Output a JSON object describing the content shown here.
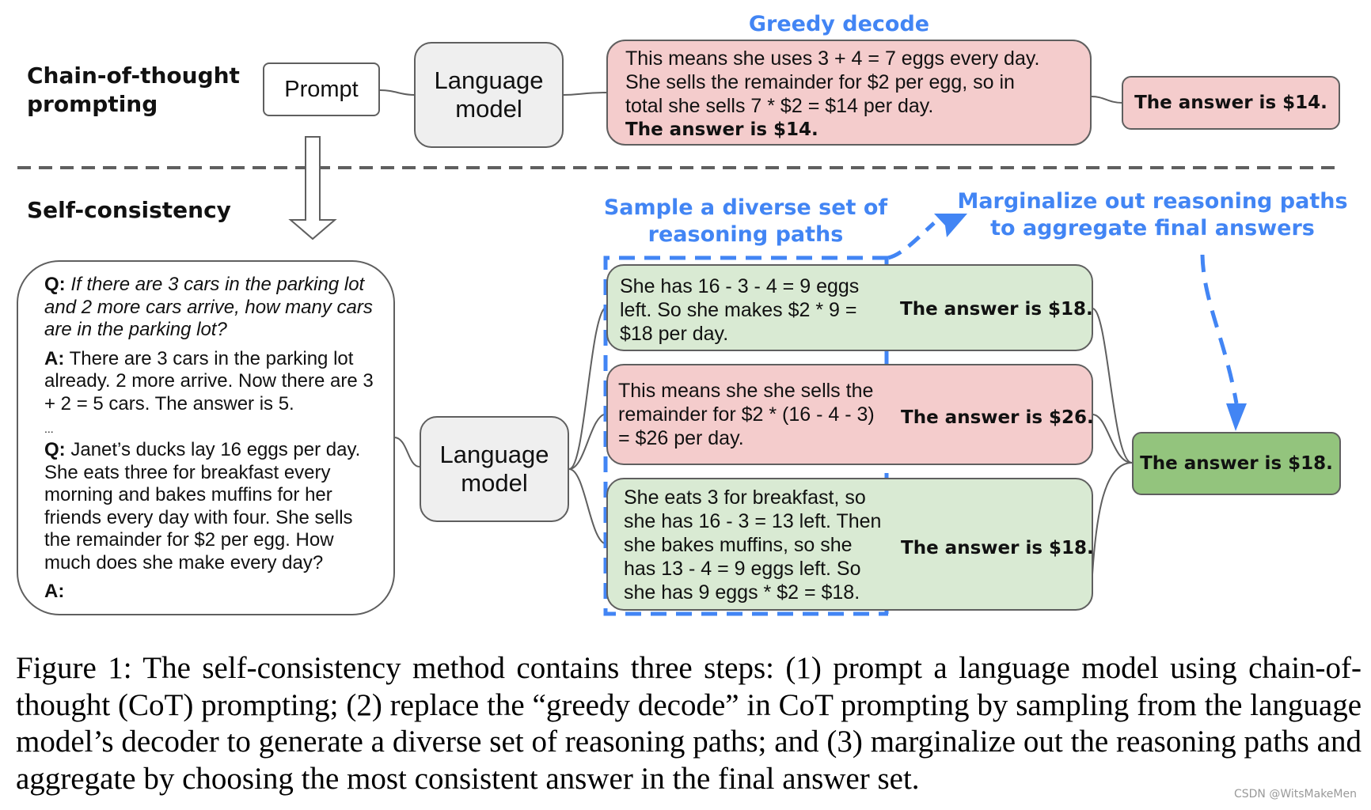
{
  "sections": {
    "cot_title": "Chain-of-thought\nprompting",
    "sc_title": "Self-consistency"
  },
  "cot": {
    "prompt_label": "Prompt",
    "lm_label_1": "Language",
    "lm_label_2": "model",
    "greedy_label": "Greedy decode",
    "greedy_lines": [
      "This means she uses 3 + 4 = 7 eggs every day.",
      "She sells the remainder for $2 per egg, so in",
      "total she sells 7 * $2 = $14 per day."
    ],
    "greedy_answer_inline": "The answer is $14.",
    "greedy_answer": "The answer is $14."
  },
  "sc": {
    "prompt": {
      "q1_label": "Q:",
      "q1_text": "If there are 3 cars in the parking lot and 2 more cars arrive, how many cars are in the parking lot?",
      "a1_label": "A:",
      "a1_text": "There are 3 cars in the parking lot already. 2 more arrive. Now there are 3 + 2 = 5 cars. The answer is 5.",
      "ellipsis": "...",
      "q2_label": "Q:",
      "q2_text": "Janet’s ducks lay 16 eggs per day. She eats three for breakfast every morning and bakes muffins for her friends every day with four. She sells the remainder for $2 per egg. How much does she make every day?",
      "a2_label": "A:"
    },
    "lm_label_1": "Language",
    "lm_label_2": "model",
    "sample_label_1": "Sample a diverse set of",
    "sample_label_2": "reasoning paths",
    "marginalize_label_1": "Marginalize out reasoning paths",
    "marginalize_label_2": "to aggregate final answers",
    "paths": [
      {
        "color": "green",
        "lines": [
          "She has 16 - 3 - 4 = 9 eggs",
          "left. So she makes $2 * 9 =",
          "$18 per day."
        ],
        "answer": "The answer is $18."
      },
      {
        "color": "pink",
        "lines": [
          "This means she she sells the",
          "remainder for $2 * (16 - 4 - 3)",
          "= $26 per day."
        ],
        "answer": "The answer is $26."
      },
      {
        "color": "green",
        "lines": [
          "She eats 3 for breakfast, so",
          "she has 16 - 3 = 13 left. Then",
          "she bakes muffins, so she",
          "has 13 - 4 = 9 eggs left. So",
          "she has 9 eggs * $2 = $18."
        ],
        "answer": "The answer is $18."
      }
    ],
    "final_answer": "The answer is $18."
  },
  "colors": {
    "accent_blue": "#4285f4",
    "pink": "#f4cccc",
    "light_green": "#d9ead3",
    "dark_green": "#93c47d",
    "lm_gray": "#efefef",
    "border": "#5f5f5f"
  },
  "caption": "Figure 1: The self-consistency method contains three steps: (1) prompt a language model using chain-of-thought (CoT) prompting; (2) replace the “greedy decode” in CoT prompting by sampling from the language model’s decoder to generate a diverse set of reasoning paths; and (3) marginalize out the reasoning paths and aggregate by choosing the most consistent answer in the final answer set.",
  "credit": "CSDN @WitsMakeMen"
}
